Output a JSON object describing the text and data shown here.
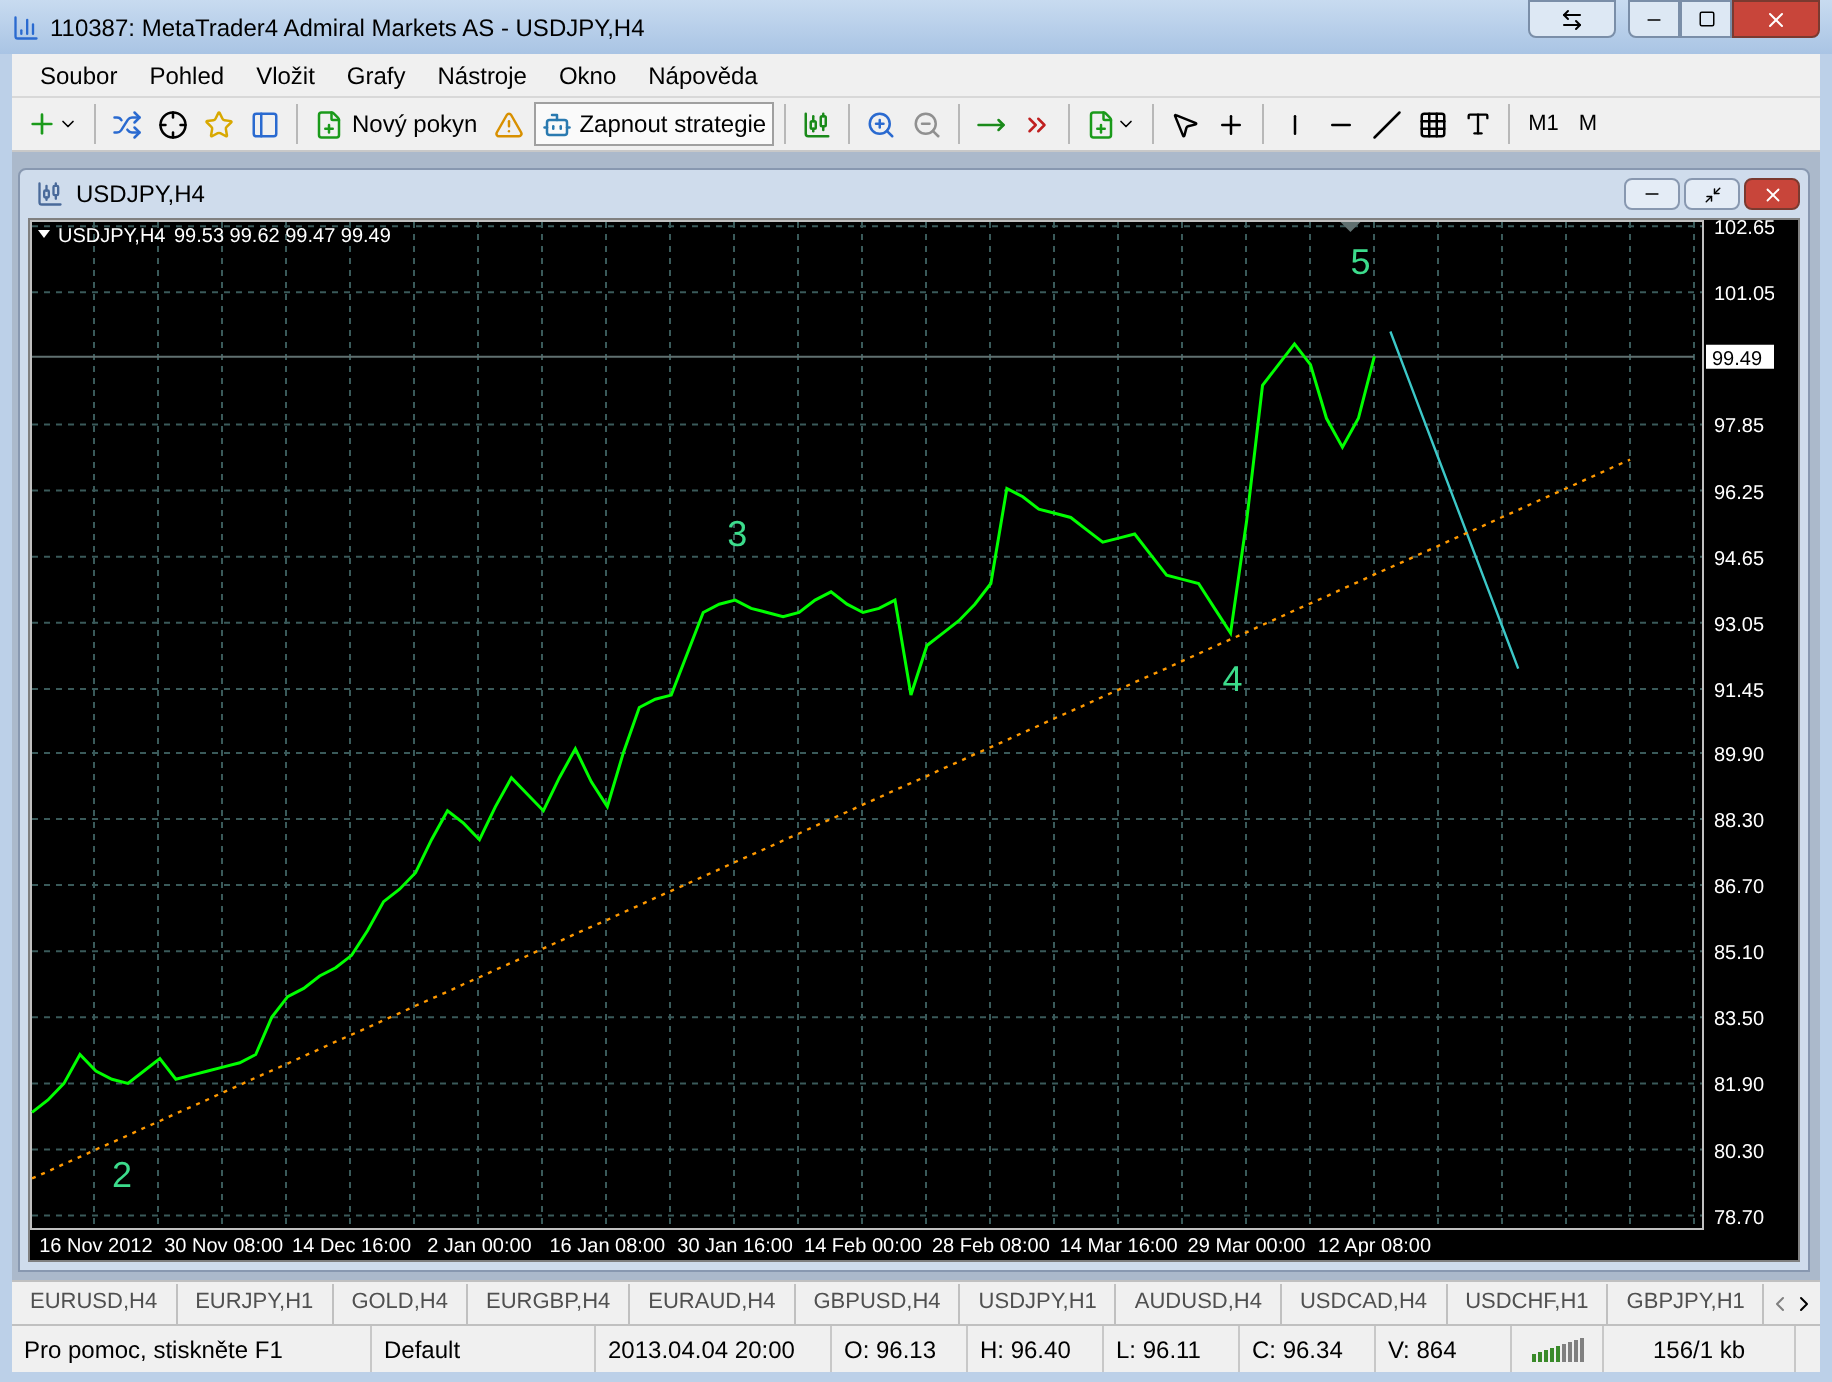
{
  "window": {
    "title": "110387: MetaTrader4 Admiral Markets AS - USDJPY,H4"
  },
  "menu": [
    "Soubor",
    "Pohled",
    "Vložit",
    "Grafy",
    "Nástroje",
    "Okno",
    "Nápověda"
  ],
  "toolbar": {
    "buttons": [
      {
        "label": "Nový pokyn"
      },
      {
        "label": "Zapnout strategie"
      }
    ],
    "timeframes": [
      "M1",
      "M"
    ]
  },
  "chart_window": {
    "title": "USDJPY,H4",
    "legend_values": "99.53 99.62 99.47 99.49",
    "price_label": "99.49",
    "chart_data": {
      "type": "line",
      "grid": true,
      "ylim": [
        78.4,
        102.8
      ],
      "categories": [
        null,
        null,
        null,
        null,
        "16 Nov 2012",
        null,
        null,
        null,
        null,
        null,
        null,
        null,
        "30 Nov 08:00",
        null,
        null,
        null,
        null,
        null,
        null,
        null,
        "14 Dec 16:00",
        null,
        null,
        null,
        null,
        null,
        null,
        null,
        "2 Jan 00:00",
        null,
        null,
        null,
        null,
        null,
        null,
        null,
        "16 Jan 08:00",
        null,
        null,
        null,
        null,
        null,
        null,
        null,
        "30 Jan 16:00",
        null,
        null,
        null,
        null,
        null,
        null,
        null,
        "14 Feb 00:00",
        null,
        null,
        null,
        null,
        null,
        null,
        null,
        "28 Feb 08:00",
        null,
        null,
        null,
        null,
        null,
        null,
        null,
        "14 Mar 16:00",
        null,
        null,
        null,
        null,
        null,
        null,
        null,
        "29 Mar 00:00",
        null,
        null,
        null,
        null,
        null,
        null,
        null,
        "12 Apr 08:00",
        null,
        null,
        null,
        null,
        null,
        null,
        null,
        null,
        null,
        null,
        null,
        null,
        null,
        null,
        null,
        null,
        null,
        null,
        null,
        null
      ],
      "yticks": [
        {
          "value": 102.65,
          "label": "102.65"
        },
        {
          "value": 101.05,
          "label": "101.05"
        },
        {
          "value": 97.85,
          "label": "97.85"
        },
        {
          "value": 96.25,
          "label": "96.25"
        },
        {
          "value": 94.65,
          "label": "94.65"
        },
        {
          "value": 93.05,
          "label": "93.05"
        },
        {
          "value": 91.45,
          "label": "91.45"
        },
        {
          "value": 89.9,
          "label": "89.90"
        },
        {
          "value": 88.3,
          "label": "88.30"
        },
        {
          "value": 86.7,
          "label": "86.70"
        },
        {
          "value": 85.1,
          "label": "85.10"
        },
        {
          "value": 83.5,
          "label": "83.50"
        },
        {
          "value": 81.9,
          "label": "81.90"
        },
        {
          "value": 80.3,
          "label": "80.30"
        },
        {
          "value": 78.7,
          "label": "78.70"
        }
      ],
      "series": [
        {
          "name": "USDJPY,H4",
          "color": "#00ff00",
          "values": [
            81.2,
            81.5,
            81.9,
            82.6,
            82.2,
            82.0,
            81.9,
            82.2,
            82.5,
            82.0,
            82.1,
            82.2,
            82.3,
            82.4,
            82.6,
            83.5,
            84.0,
            84.2,
            84.5,
            84.7,
            85.0,
            85.6,
            86.3,
            86.6,
            87.0,
            87.8,
            88.5,
            88.2,
            87.8,
            88.6,
            89.3,
            88.9,
            88.5,
            89.3,
            90.0,
            89.2,
            88.6,
            89.9,
            91.0,
            91.2,
            91.3,
            92.3,
            93.3,
            93.5,
            93.6,
            93.4,
            93.3,
            93.2,
            93.3,
            93.6,
            93.8,
            93.5,
            93.3,
            93.4,
            93.6,
            91.3,
            92.5,
            92.8,
            93.1,
            93.5,
            94.0,
            96.3,
            96.1,
            95.8,
            95.7,
            95.6,
            95.3,
            95.0,
            95.1,
            95.2,
            94.7,
            94.2,
            94.1,
            94.0,
            93.4,
            92.8,
            95.5,
            98.8,
            99.3,
            99.8,
            99.3,
            98.0,
            97.3,
            98.0,
            99.5,
            null,
            null,
            null,
            null,
            null,
            null,
            null,
            null,
            null,
            null,
            null,
            null,
            null,
            null,
            null,
            null,
            null,
            null,
            null,
            null
          ]
        },
        {
          "color": "#ff9900",
          "line_style": "dotted",
          "values": [
            79.6,
            79.77,
            79.95,
            80.12,
            80.3,
            80.47,
            80.64,
            80.82,
            80.99,
            81.17,
            81.34,
            81.51,
            81.69,
            81.86,
            82.04,
            82.21,
            82.38,
            82.56,
            82.73,
            82.91,
            83.08,
            83.25,
            83.43,
            83.6,
            83.78,
            83.95,
            84.12,
            84.3,
            84.47,
            84.65,
            84.82,
            84.99,
            85.17,
            85.34,
            85.52,
            85.69,
            85.86,
            86.04,
            86.21,
            86.39,
            86.56,
            86.73,
            86.91,
            87.08,
            87.26,
            87.43,
            87.6,
            87.78,
            87.95,
            88.13,
            88.3,
            88.47,
            88.65,
            88.82,
            89.0,
            89.17,
            89.34,
            89.52,
            89.69,
            89.87,
            90.04,
            90.21,
            90.39,
            90.56,
            90.74,
            90.91,
            91.08,
            91.26,
            91.43,
            91.61,
            91.78,
            91.95,
            92.13,
            92.3,
            92.48,
            92.65,
            92.82,
            93.0,
            93.17,
            93.35,
            93.52,
            93.69,
            93.87,
            94.04,
            94.22,
            94.39,
            94.56,
            94.74,
            94.91,
            95.09,
            95.26,
            95.43,
            95.61,
            95.78,
            95.96,
            96.13,
            96.3,
            96.48,
            96.65,
            96.83,
            97.0,
            null,
            null,
            null,
            null
          ]
        },
        {
          "color": "#3cc8c8",
          "values": [
            null,
            null,
            null,
            null,
            null,
            null,
            null,
            null,
            null,
            null,
            null,
            null,
            null,
            null,
            null,
            null,
            null,
            null,
            null,
            null,
            null,
            null,
            null,
            null,
            null,
            null,
            null,
            null,
            null,
            null,
            null,
            null,
            null,
            null,
            null,
            null,
            null,
            null,
            null,
            null,
            null,
            null,
            null,
            null,
            null,
            null,
            null,
            null,
            null,
            null,
            null,
            null,
            null,
            null,
            null,
            null,
            null,
            null,
            null,
            null,
            null,
            null,
            null,
            null,
            null,
            null,
            null,
            null,
            null,
            null,
            null,
            null,
            null,
            null,
            null,
            null,
            null,
            null,
            null,
            null,
            null,
            null,
            null,
            null,
            null,
            100.1,
            99.08,
            98.06,
            97.04,
            96.02,
            95.0,
            93.98,
            92.96,
            91.94,
            null,
            null,
            null,
            null,
            null,
            null,
            null,
            null,
            null,
            null,
            null
          ]
        },
        {
          "color": "#607070",
          "values": [
            99.49,
            99.49,
            99.49,
            99.49,
            99.49,
            99.49,
            99.49,
            99.49,
            99.49,
            99.49,
            99.49,
            99.49,
            99.49,
            99.49,
            99.49,
            99.49,
            99.49,
            99.49,
            99.49,
            99.49,
            99.49,
            99.49,
            99.49,
            99.49,
            99.49,
            99.49,
            99.49,
            99.49,
            99.49,
            99.49,
            99.49,
            99.49,
            99.49,
            99.49,
            99.49,
            99.49,
            99.49,
            99.49,
            99.49,
            99.49,
            99.49,
            99.49,
            99.49,
            99.49,
            99.49,
            99.49,
            99.49,
            99.49,
            99.49,
            99.49,
            99.49,
            99.49,
            99.49,
            99.49,
            99.49,
            99.49,
            99.49,
            99.49,
            99.49,
            99.49,
            99.49,
            99.49,
            99.49,
            99.49,
            99.49,
            99.49,
            99.49,
            99.49,
            99.49,
            99.49,
            99.49,
            99.49,
            99.49,
            99.49,
            99.49,
            99.49,
            99.49,
            99.49,
            99.49,
            99.49,
            99.49,
            99.49,
            99.49,
            99.49,
            99.49,
            99.49,
            99.49,
            99.49,
            99.49,
            99.49,
            99.49,
            99.49,
            99.49,
            99.49,
            99.49,
            99.49,
            99.49,
            99.49,
            99.49,
            99.49,
            99.49,
            99.49,
            99.49,
            99.49,
            99.49
          ]
        }
      ],
      "annotations": [
        "2",
        "3",
        "4",
        "5"
      ]
    }
  },
  "tabs": [
    {
      "label": "EURUSD,H4",
      "selected": false
    },
    {
      "label": "EURJPY,H1",
      "selected": false
    },
    {
      "label": "GOLD,H4",
      "selected": false
    },
    {
      "label": "EURGBP,H4",
      "selected": false
    },
    {
      "label": "EURAUD,H4",
      "selected": false
    },
    {
      "label": "GBPUSD,H4",
      "selected": false
    },
    {
      "label": "USDJPY,H1",
      "selected": false
    },
    {
      "label": "AUDUSD,H4",
      "selected": false
    },
    {
      "label": "USDCAD,H4",
      "selected": false
    },
    {
      "label": "USDCHF,H1",
      "selected": false
    },
    {
      "label": "GBPJPY,H1",
      "selected": false
    }
  ],
  "status_bar": [
    "Pro pomoc, stiskněte F1",
    "Default",
    "2013.04.04 20:00",
    "O: 96.13",
    "H: 96.40",
    "L: 96.11",
    "C: 96.34",
    "V: 864",
    "156/1 kb"
  ]
}
